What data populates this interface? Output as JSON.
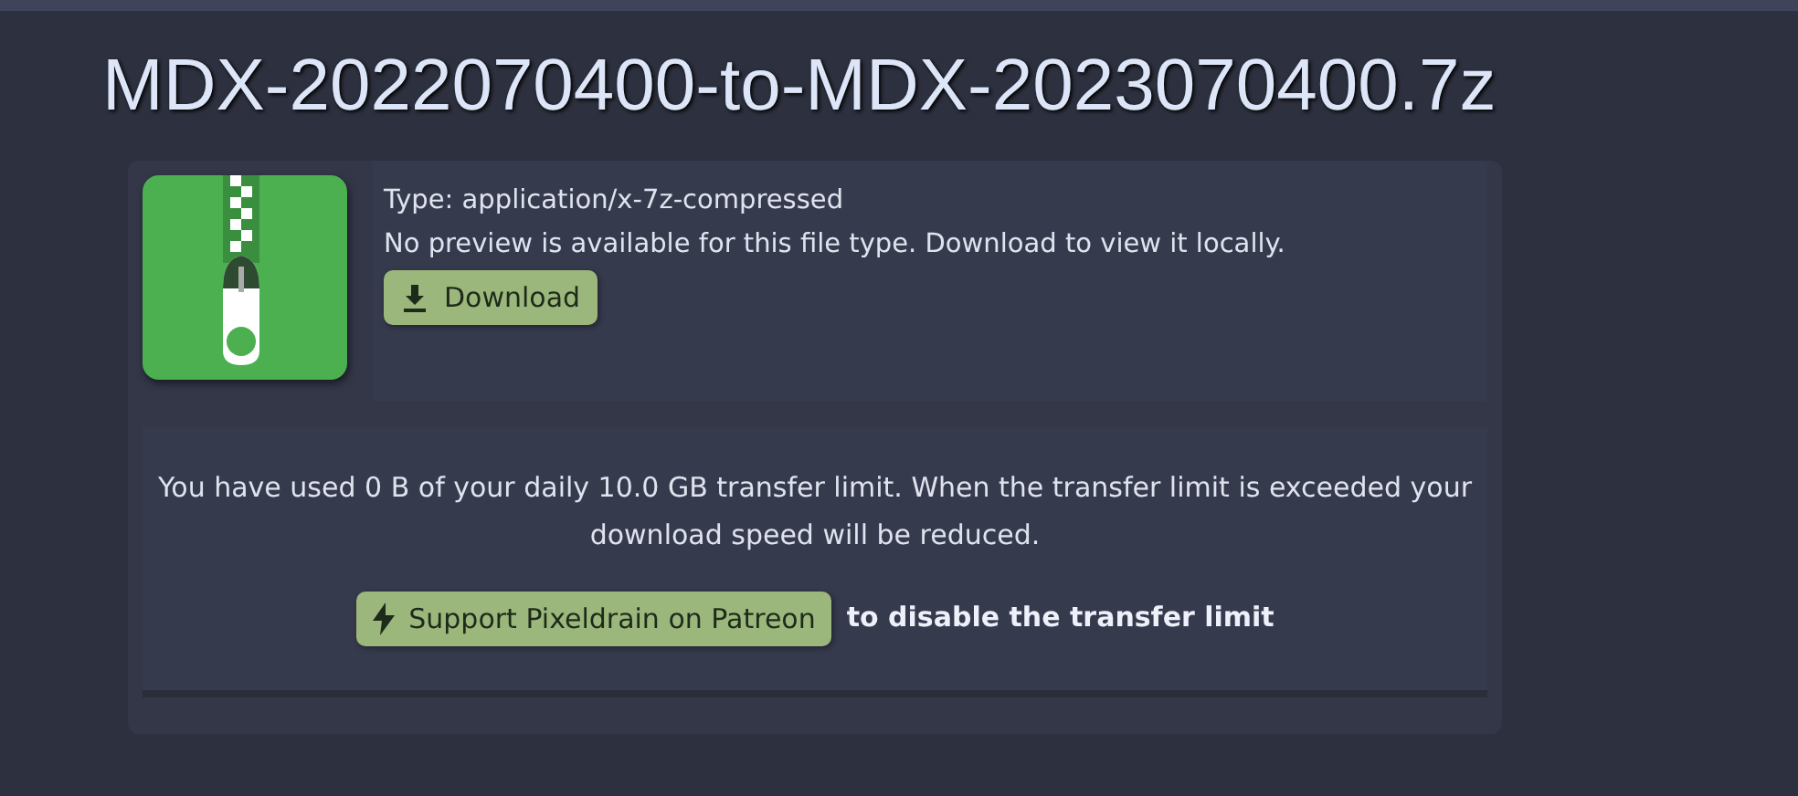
{
  "title": "MDX-2022070400-to-MDX-2023070400.7z",
  "file": {
    "type_line": "Type: application/x-7z-compressed",
    "preview_note": "No preview is available for this file type. Download to view it locally.",
    "download_button": "Download"
  },
  "transfer": {
    "message": "You have used 0 B of your daily 10.0 GB transfer limit. When the transfer limit is exceeded your download speed will be reduced.",
    "support_button": "Support Pixeldrain on Patreon",
    "support_note": "to disable the transfer limit"
  }
}
